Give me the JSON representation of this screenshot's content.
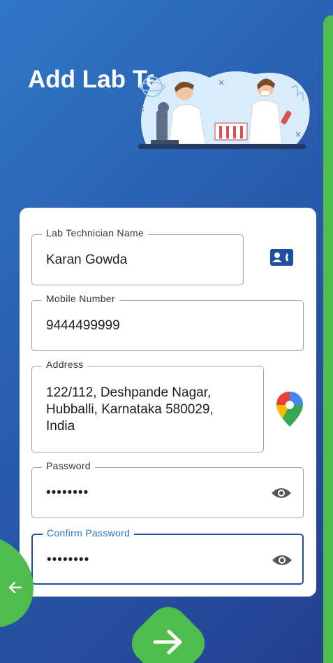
{
  "header": {
    "title": "Add Lab Technician"
  },
  "form": {
    "name": {
      "label": "Lab Technician Name",
      "value": "Karan Gowda"
    },
    "mobile": {
      "label": "Mobile Number",
      "value": "9444499999"
    },
    "address": {
      "label": "Address",
      "line1": "122/112, Deshpande Nagar,",
      "line2": "Hubballi, Karnataka 580029,",
      "line3": "India"
    },
    "password": {
      "label": "Password",
      "value": "••••••••"
    },
    "confirm_password": {
      "label": "Confirm Password",
      "value": "••••••••"
    }
  },
  "icons": {
    "contact": "contact-card-icon",
    "location": "map-pin-icon",
    "eye": "eye-icon",
    "back": "arrow-left-icon",
    "next": "arrow-right-icon"
  },
  "colors": {
    "accent_green": "#4ebd4c",
    "primary_blue": "#1f4fa0",
    "focus_label": "#2a78c7"
  }
}
